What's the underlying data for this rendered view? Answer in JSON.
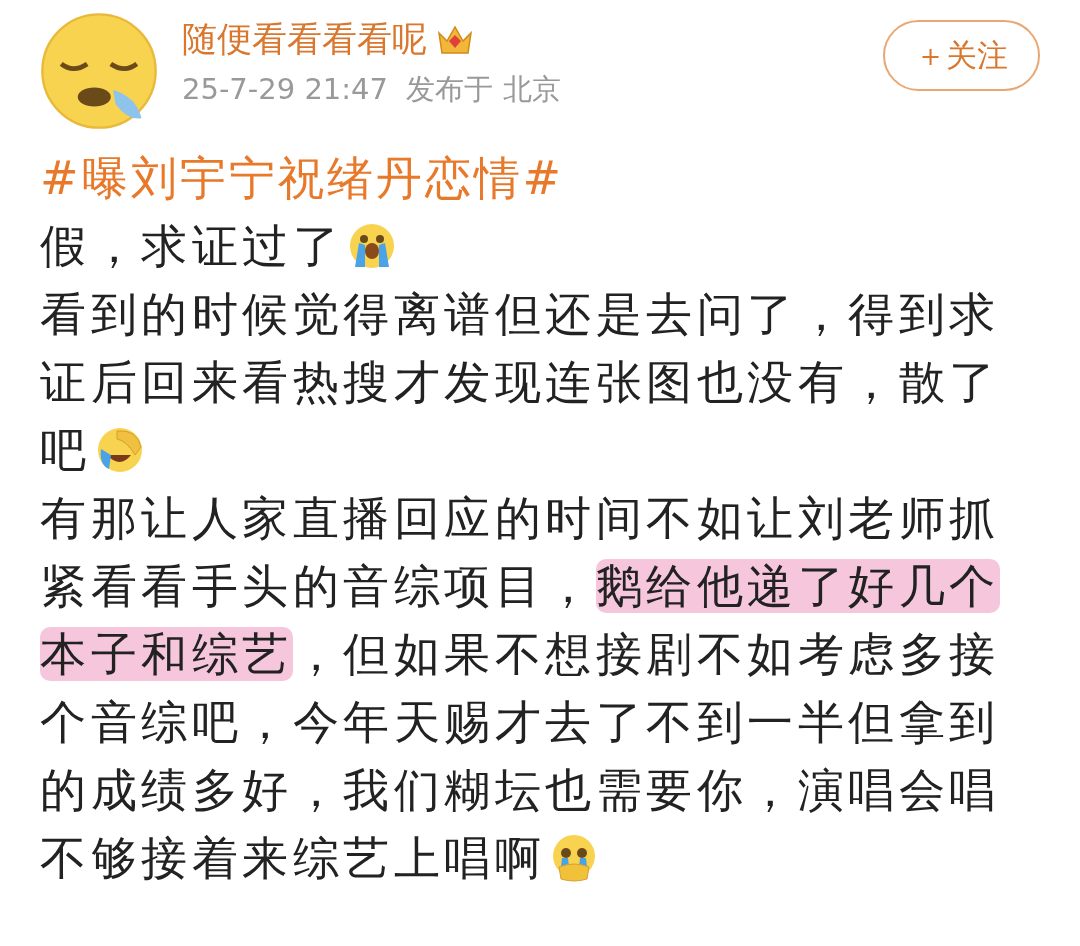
{
  "author": {
    "name": "随便看看看看呢",
    "badge": {
      "kind": "crown"
    },
    "meta": "25-7-29 21:47  发布于 北京"
  },
  "follow_button": {
    "label": "＋关注"
  },
  "hashtag": "#曝刘宇宁祝绪丹恋情#",
  "paragraphs": [
    {
      "lines": [
        {
          "segments": [
            {
              "text": "假，求证过了",
              "highlighted": false
            }
          ]
        }
      ],
      "emoji": {
        "kind": "crying"
      }
    },
    {
      "lines": [
        {
          "segments": [
            {
              "text": "看到的时候觉得离谱但还是去问了，得到求",
              "highlighted": false
            }
          ]
        },
        {
          "segments": [
            {
              "text": "证后回来看热搜才发现连张图也没有，散了",
              "highlighted": false
            }
          ]
        },
        {
          "segments": [
            {
              "text": "吧",
              "highlighted": false
            }
          ]
        }
      ],
      "emoji": {
        "kind": "facepalm"
      }
    },
    {
      "lines": [
        {
          "segments": [
            {
              "text": "有那让人家直播回应的时间不如让刘老师抓",
              "highlighted": false
            }
          ]
        },
        {
          "segments": [
            {
              "text": "紧看看手头的音综项目，",
              "highlighted": false
            },
            {
              "text": "鹅给他递了好几个",
              "highlighted": true
            }
          ]
        },
        {
          "segments": [
            {
              "text": "本子和综艺",
              "highlighted": true
            },
            {
              "text": "，但如果不想接剧不如考虑多接",
              "highlighted": false
            }
          ]
        },
        {
          "segments": [
            {
              "text": "个音综吧，今年天赐才去了不到一半但拿到",
              "highlighted": false
            }
          ]
        },
        {
          "segments": [
            {
              "text": "的成绩多好，我们糊坛也需要你，演唱会唱",
              "highlighted": false
            }
          ]
        },
        {
          "segments": [
            {
              "text": "不够接着来综艺上唱啊",
              "highlighted": false
            }
          ]
        }
      ],
      "emoji": {
        "kind": "tearful"
      }
    }
  ]
}
